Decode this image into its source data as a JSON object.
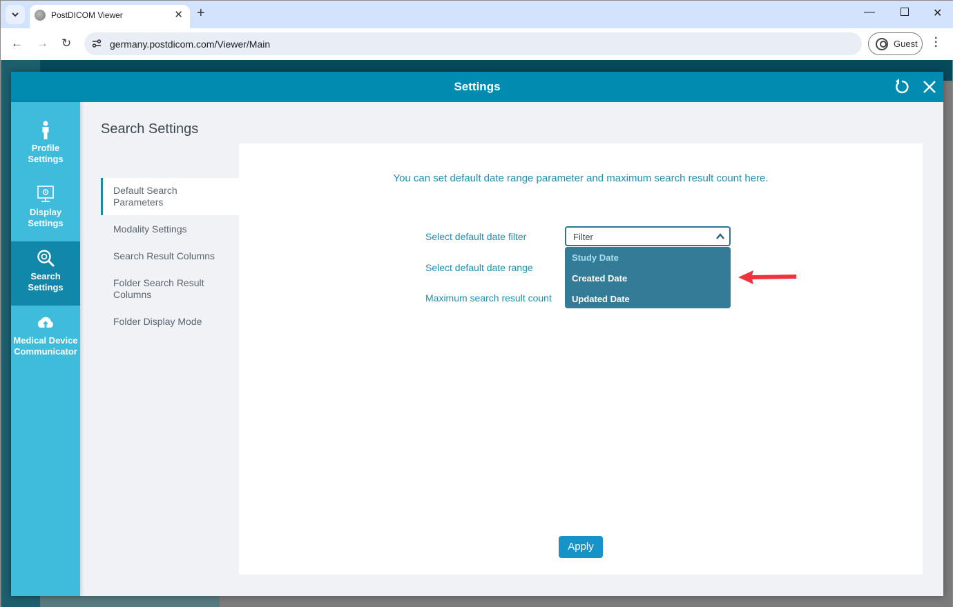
{
  "browser": {
    "tab_title": "PostDICOM Viewer",
    "url": "germany.postdicom.com/Viewer/Main",
    "profile_label": "Guest",
    "icons": {
      "tab_search": "chevron-down-icon",
      "favicon": "postdicom-favicon",
      "tab_close": "close-icon",
      "new_tab": "plus-icon",
      "back": "arrow-left-icon",
      "forward": "arrow-right-icon",
      "reload": "reload-icon",
      "site_info": "tune-icon",
      "profile": "account-circle-icon",
      "menu": "kebab-menu-icon",
      "minimize": "minimize-icon",
      "maximize": "maximize-icon",
      "close": "close-icon"
    }
  },
  "modal": {
    "title": "Settings",
    "reset_icon": "reset-icon",
    "close_icon": "close-icon",
    "colors": {
      "header": "#018bb1",
      "sidebar": "#3fbcdb",
      "sidebar_active": "#1187a9",
      "accent_text": "#1e8fb3",
      "dropdown": "#337b97",
      "apply": "#1793c8"
    },
    "sidebar": [
      {
        "label_line1": "Profile",
        "label_line2": "Settings",
        "icon": "person-icon",
        "active": false
      },
      {
        "label_line1": "Display",
        "label_line2": "Settings",
        "icon": "monitor-gear-icon",
        "active": false
      },
      {
        "label_line1": "Search",
        "label_line2": "Settings",
        "icon": "search-gear-icon",
        "active": true
      },
      {
        "label_line1": "Medical Device",
        "label_line2": "Communicator",
        "icon": "cloud-upload-icon",
        "active": false
      }
    ],
    "section_title": "Search Settings",
    "sub_nav": [
      {
        "line1": "Default Search",
        "line2": "Parameters",
        "active": true
      },
      {
        "line1": "Modality Settings",
        "line2": "",
        "active": false
      },
      {
        "line1": "Search Result Columns",
        "line2": "",
        "active": false
      },
      {
        "line1": "Folder Search Result",
        "line2": "Columns",
        "active": false
      },
      {
        "line1": "Folder Display Mode",
        "line2": "",
        "active": false
      }
    ],
    "content": {
      "intro": "You can set default date range parameter and maximum search result count here.",
      "labels": {
        "date_filter": "Select default date filter",
        "date_range": "Select default date range",
        "max_count": "Maximum search result count"
      },
      "date_filter_select": {
        "value": "Filter",
        "expanded": true,
        "options": [
          "Study Date",
          "Created Date",
          "Updated Date"
        ],
        "highlighted": "Study Date"
      },
      "apply_label": "Apply"
    },
    "annotation": {
      "type": "red-arrow-icon",
      "color": "#f0323c",
      "points_to": "Created Date"
    }
  }
}
